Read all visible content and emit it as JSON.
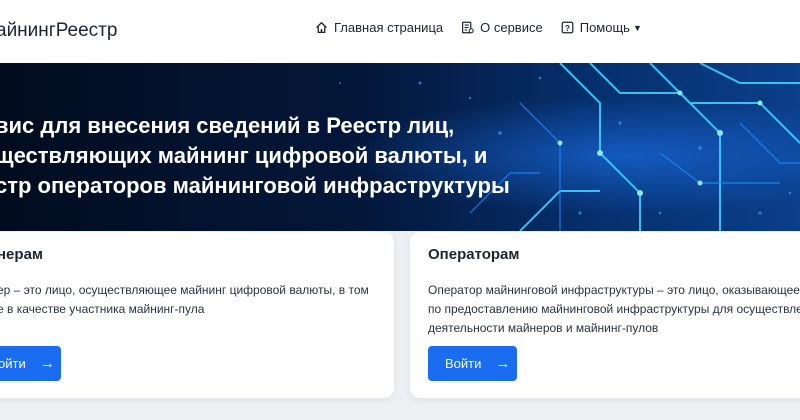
{
  "header": {
    "logo": "айнингРеестр",
    "nav": [
      {
        "label": "Главная страница",
        "icon": "home-icon"
      },
      {
        "label": "О сервисе",
        "icon": "document-icon"
      },
      {
        "label": "Помощь",
        "icon": "question-icon"
      }
    ]
  },
  "hero": {
    "lines": [
      "вис для внесения сведений в Реестр лиц,",
      "ществляющих майнинг цифровой валюты, и",
      "стр операторов майнинговой инфраструктуры"
    ]
  },
  "cards": {
    "miners": {
      "title": "нерам",
      "desc_lines": [
        "ер – это лицо, осуществляющее майнинг цифровой валюты, в том",
        "е в качестве участника майнинг-пула"
      ],
      "button": "ойти"
    },
    "operators": {
      "title": "Операторам",
      "desc_lines": [
        "Оператор майнинговой инфраструктуры – это лицо, оказывающее у",
        "по предоставлению майнинговой инфраструктуры для осуществлен",
        "деятельности майнеров и майнинг-пулов"
      ],
      "button": "Войти"
    }
  },
  "colors": {
    "accent": "#1a6df0",
    "hero_bg": "#041a3c",
    "page_bg": "#eef0f4"
  }
}
